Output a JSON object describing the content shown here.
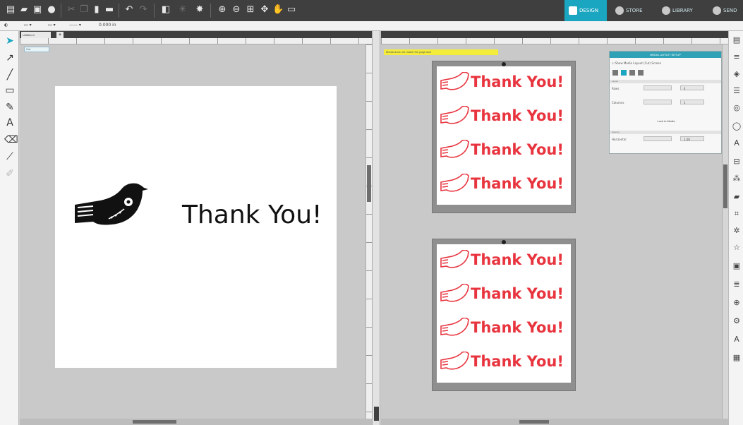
{
  "nav": {
    "design_label": "DESIGN",
    "store_label": "STORE",
    "library_label": "LIBRARY",
    "send_label": "SEND"
  },
  "subbar": {
    "line_value": "0.000 in"
  },
  "left_panel": {
    "doc_tab_label": "Untitled-1",
    "cut_label": "Cut",
    "artwork_text": "Thank You!"
  },
  "right_panel": {
    "warning_text": "Media does not match the page size",
    "tile_text": "Thank You!",
    "tiles_per_sheet": 4,
    "media_layout": {
      "title": "MEDIA LAYOUT SETUP",
      "show_option": "Show Media Layout (Cut) Screen",
      "layout_section": "Layout",
      "rows_label": "Rows",
      "rows_value": "4",
      "columns_label": "Columns",
      "columns_value": "1",
      "lock_button": "Lock to Media",
      "spacing_section": "Spacing",
      "horizontal_label": "Horizontal",
      "horizontal_value": "1.00"
    }
  },
  "colors": {
    "accent": "#1aa5c0",
    "tile_red": "#e8343e"
  }
}
